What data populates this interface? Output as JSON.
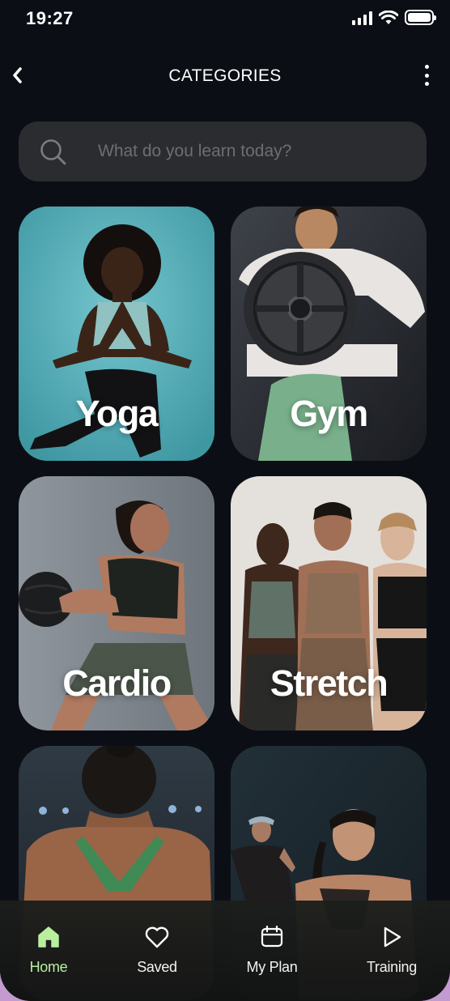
{
  "status_bar": {
    "time": "19:27"
  },
  "header": {
    "title": "CATEGORIES"
  },
  "search": {
    "placeholder": "What do you learn today?"
  },
  "categories": [
    {
      "label": "Yoga"
    },
    {
      "label": "Gym"
    },
    {
      "label": "Cardio"
    },
    {
      "label": "Stretch"
    },
    {
      "label": ""
    },
    {
      "label": ""
    }
  ],
  "nav": {
    "items": [
      {
        "label": "Home",
        "icon": "home-icon",
        "active": true
      },
      {
        "label": "Saved",
        "icon": "heart-icon"
      },
      {
        "label": "My Plan",
        "icon": "calendar-icon"
      },
      {
        "label": "Training",
        "icon": "play-icon"
      }
    ]
  },
  "colors": {
    "background": "#0b0f15",
    "accent": "#b9ee9f",
    "search_bg": "#2b2c30",
    "frame": "#c39bd0"
  }
}
